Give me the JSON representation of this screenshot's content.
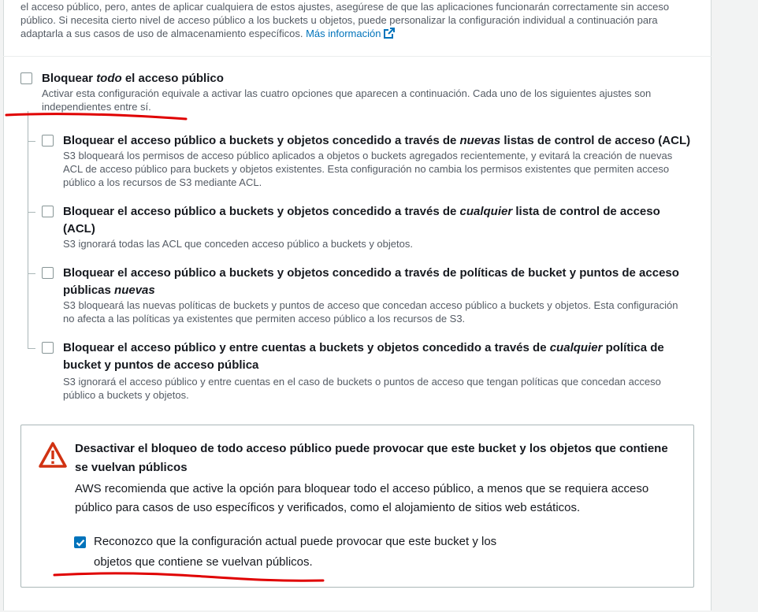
{
  "intro": {
    "text": "el acceso público, pero, antes de aplicar cualquiera de estos ajustes, asegúrese de que las aplicaciones funcionarán correctamente sin acceso público. Si necesita cierto nivel de acceso público a los buckets u objetos, puede personalizar la configuración individual a continuación para adaptarla a sus casos de uso de almacenamiento específicos.",
    "link": "Más información"
  },
  "block_all": {
    "title_prefix": "Bloquear ",
    "title_em": "todo",
    "title_suffix": " el acceso público",
    "desc": "Activar esta configuración equivale a activar las cuatro opciones que aparecen a continuación. Cada uno de los siguientes ajustes son independientes entre sí.",
    "checked": false
  },
  "options": [
    {
      "title_prefix": "Bloquear el acceso público a buckets y objetos concedido a través de ",
      "title_em": "nuevas",
      "title_suffix": " listas de control de acceso (ACL)",
      "desc": "S3 bloqueará los permisos de acceso público aplicados a objetos o buckets agregados recientemente, y evitará la creación de nuevas ACL de acceso público para buckets y objetos existentes. Esta configuración no cambia los permisos existentes que permiten acceso público a los recursos de S3 mediante ACL."
    },
    {
      "title_prefix": "Bloquear el acceso público a buckets y objetos concedido a través de ",
      "title_em": "cualquier",
      "title_suffix": " lista de control de acceso (ACL)",
      "desc": "S3 ignorará todas las ACL que conceden acceso público a buckets y objetos."
    },
    {
      "title_prefix": "Bloquear el acceso público a buckets y objetos concedido a través de políticas de bucket y puntos de acceso públicas ",
      "title_em": "nuevas",
      "title_suffix": "",
      "desc": "S3 bloqueará las nuevas políticas de buckets y puntos de acceso que concedan acceso público a buckets y objetos. Esta configuración no afecta a las políticas ya existentes que permiten acceso público a los recursos de S3."
    },
    {
      "title_prefix": "Bloquear el acceso público y entre cuentas a buckets y objetos concedido a través de ",
      "title_em": "cualquier",
      "title_suffix": " política de bucket y puntos de acceso pública",
      "desc": "S3 ignorará el acceso público y entre cuentas en el caso de buckets o puntos de acceso que tengan políticas que concedan acceso público a buckets y objetos."
    }
  ],
  "warning": {
    "title": "Desactivar el bloqueo de todo acceso público puede provocar que este bucket y los objetos que contiene se vuelvan públicos",
    "desc": "AWS recomienda que active la opción para bloquear todo el acceso público, a menos que se requiera acceso público para casos de uso específicos y verificados, como el alojamiento de sitios web estáticos.",
    "ack_label": "Reconozco que la configuración actual puede provocar que este bucket y los objetos que contiene se vuelvan públicos.",
    "ack_checked": true
  },
  "colors": {
    "link": "#0073bb",
    "checkbox_checked": "#0073bb",
    "warning_icon": "#d13212",
    "annotation": "#e00000"
  }
}
